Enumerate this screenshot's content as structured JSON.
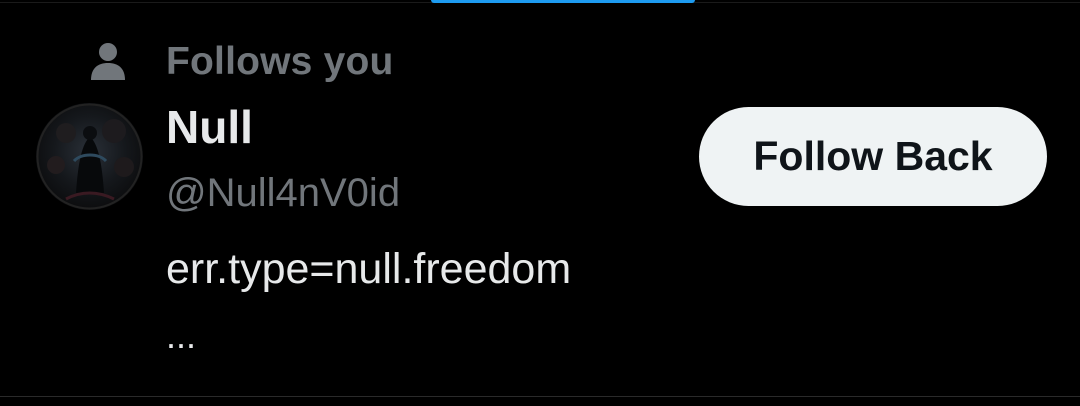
{
  "context": {
    "icon": "person-icon",
    "text": "Follows you"
  },
  "user": {
    "display_name": "Null",
    "handle": "@Null4nV0id",
    "bio": "err.type=null.freedom",
    "bio_more": "...",
    "avatar": "dark-figure-avatar"
  },
  "actions": {
    "follow_label": "Follow Back"
  },
  "colors": {
    "background": "#000000",
    "primary_text": "#e7e9ea",
    "secondary_text": "#71767b",
    "button_bg": "#eff3f4",
    "button_text": "#0f1419",
    "accent": "#1d9bf0"
  }
}
